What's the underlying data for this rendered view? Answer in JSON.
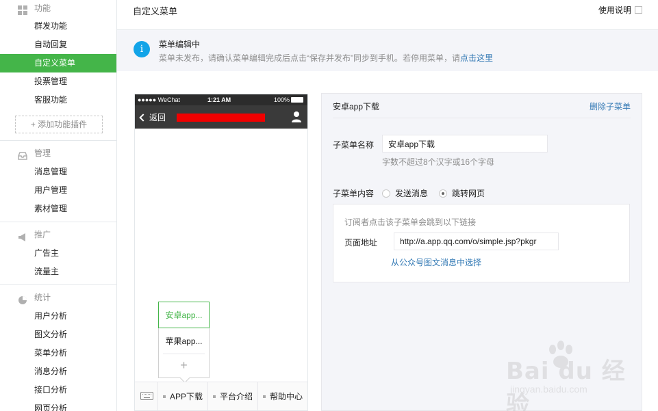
{
  "sidebar": {
    "groups": [
      {
        "title": "功能",
        "icon": "grid-icon",
        "items": [
          "群发功能",
          "自动回复",
          "自定义菜单",
          "投票管理",
          "客服功能"
        ],
        "add_plugin": "+ 添加功能插件"
      },
      {
        "title": "管理",
        "icon": "inbox-icon",
        "items": [
          "消息管理",
          "用户管理",
          "素材管理"
        ]
      },
      {
        "title": "推广",
        "icon": "megaphone-icon",
        "items": [
          "广告主",
          "流量主"
        ]
      },
      {
        "title": "统计",
        "icon": "pie-chart-icon",
        "items": [
          "用户分析",
          "图文分析",
          "菜单分析",
          "消息分析",
          "接口分析",
          "网页分析"
        ]
      }
    ],
    "active_item": "自定义菜单"
  },
  "header": {
    "title": "自定义菜单",
    "help": "使用说明"
  },
  "notice": {
    "title": "菜单编辑中",
    "text": "菜单未发布，请确认菜单编辑完成后点击“保存并发布”同步到手机。若停用菜单，请",
    "link": "点击这里"
  },
  "phone": {
    "status": {
      "carrier": "●●●●● WeChat",
      "time": "1:21 AM",
      "battery": "100%"
    },
    "back": "返回",
    "submenu": [
      "安卓app...",
      "苹果app..."
    ],
    "submenu_add": "+",
    "menubar": [
      "APP下载",
      "平台介绍",
      "帮助中心"
    ]
  },
  "editor": {
    "title": "安卓app下载",
    "delete": "删除子菜单",
    "name_label": "子菜单名称",
    "name_value": "安卓app下载",
    "name_hint": "字数不超过8个汉字或16个字母",
    "content_label": "子菜单内容",
    "option_send": "发送消息",
    "option_jump": "跳转网页",
    "selected_option": "跳转网页",
    "url_desc": "订阅者点击该子菜单会跳到以下链接",
    "url_label": "页面地址",
    "url_value": "http://a.app.qq.com/o/simple.jsp?pkgr",
    "url_pick": "从公众号图文消息中选择"
  },
  "watermark": {
    "brand": "Bai du 经验",
    "sub": "jingyan.baidu.com"
  },
  "colors": {
    "accent": "#44b549",
    "link": "#3178b4",
    "info": "#12a4e8",
    "redact": "#f10000"
  }
}
